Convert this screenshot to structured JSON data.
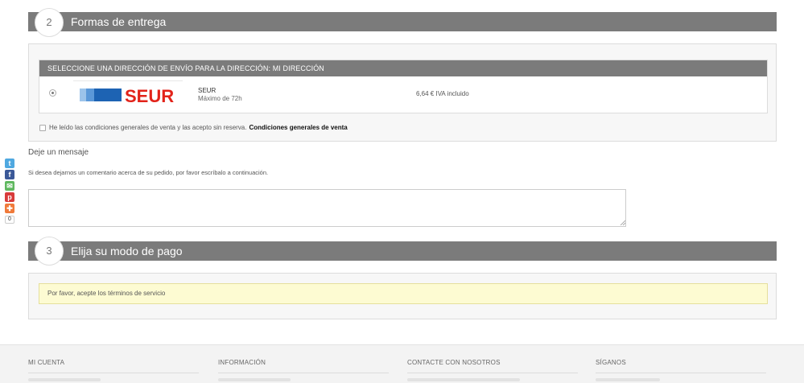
{
  "social": {
    "twitter_glyph": "t",
    "facebook_glyph": "f",
    "email_glyph": "✉",
    "pinterest_glyph": "p",
    "share_glyph": "✚",
    "count": "0"
  },
  "step2": {
    "number": "2",
    "title": "Formas de entrega"
  },
  "delivery": {
    "header": "SELECCIONE UNA DIRECCIÓN DE ENVÍO PARA LA DIRECCIÓN: MI DIRECCIÓN",
    "carrier": {
      "logo_text": "SEUR",
      "name": "SEUR",
      "delay": "Máximo de 72h",
      "price": "6,64 € IVA incluido"
    },
    "terms_text": "He leído las condiciones generales de venta y las acepto sin reserva.",
    "terms_link": "Condiciones generales de venta"
  },
  "message": {
    "title": "Deje un mensaje",
    "help": "Si desea dejarnos un comentario acerca de su pedido, por favor escríbalo a continuación.",
    "value": ""
  },
  "step3": {
    "number": "3",
    "title": "Elija su modo de pago"
  },
  "payment": {
    "warning": "Por favor, acepte los términos de servicio"
  },
  "footer": {
    "col1": "MI CUENTA",
    "col2": "INFORMACIÓN",
    "col3": "CONTACTE CON NOSOTROS",
    "col4": "SÍGANOS"
  },
  "colors": {
    "header_bar": "#7b7b7b",
    "seur_red": "#e2231a",
    "seur_blue": "#1d63b3",
    "warning_bg": "#fdfbd2"
  }
}
